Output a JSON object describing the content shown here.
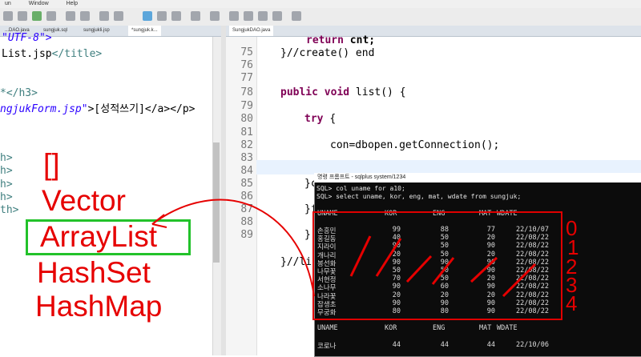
{
  "menu": {
    "items": [
      "un",
      "Window",
      "Help"
    ]
  },
  "left_tabs": [
    "...DAO.java",
    "sungjuk.sql",
    "sungjukli.jsp",
    "*sungjuk.k...",
    "SungjukDAO.java"
  ],
  "left_code": {
    "line1": "\"UTF-8\">",
    "line2_title": "List.jsp",
    "line2_close": "</title>",
    "line3": "*</h3>",
    "line4_href": "ngjukForm.jsp\"",
    "line4_text": ">[성적쓰기]</a></p>",
    "line5": "h>",
    "line6": "h>",
    "line7": "h>",
    "line8": "h>",
    "line9": "th>"
  },
  "annotations": {
    "brackets": "[]",
    "vector": "Vector",
    "arraylist": "ArrayList",
    "hashset": "HashSet",
    "hashmap": "HashMap",
    "indices": [
      "0",
      "1",
      "2",
      "3",
      "4"
    ]
  },
  "right_editor": {
    "line_numbers": [
      "75",
      "76",
      "77",
      "78",
      "79",
      "80",
      "81",
      "82",
      "83",
      "84",
      "85",
      "86",
      "87",
      "88",
      "89"
    ],
    "code_return": "return cnt;",
    "code_end_create": "}//create() end",
    "code_list_decl": "public void list() {",
    "code_try": "try {",
    "code_con": "con=dbopen.getConnection();",
    "code_close1": "}c",
    "code_close2": "}f",
    "code_close3": "}",
    "code_end_list": "}//li"
  },
  "console": {
    "title": "명령 프롬프트 - sqlplus system/1234",
    "cmd1": "SQL> col uname for a10;",
    "cmd2": "SQL> select uname, kor, eng, mat, wdate from sungjuk;",
    "headers": [
      "UNAME",
      "KOR",
      "ENG",
      "MAT",
      "WDATE"
    ],
    "rows": [
      [
        "손흥민",
        "99",
        "88",
        "77",
        "22/10/07"
      ],
      [
        "홍길동",
        "40",
        "50",
        "20",
        "22/08/22"
      ],
      [
        "지라이",
        "90",
        "50",
        "90",
        "22/08/22"
      ],
      [
        "개나리",
        "20",
        "50",
        "20",
        "22/08/22"
      ],
      [
        "봉선화",
        "90",
        "90",
        "90",
        "22/08/22"
      ],
      [
        "나무꽃",
        "50",
        "50",
        "90",
        "22/08/22"
      ],
      [
        "서현정",
        "70",
        "50",
        "20",
        "22/08/22"
      ],
      [
        "소나무",
        "90",
        "60",
        "90",
        "22/08/22"
      ],
      [
        "나라꽃",
        "20",
        "20",
        "20",
        "22/08/22"
      ],
      [
        "잡생초",
        "90",
        "90",
        "90",
        "22/08/22"
      ],
      [
        "무궁화",
        "80",
        "80",
        "90",
        "22/08/22"
      ]
    ],
    "last_row": [
      "코로나",
      "44",
      "44",
      "44",
      "22/10/06"
    ]
  },
  "colors": {
    "annotation_red": "#e60000",
    "highlight_green": "#22c22a",
    "console_bg": "#0c0c0c"
  }
}
